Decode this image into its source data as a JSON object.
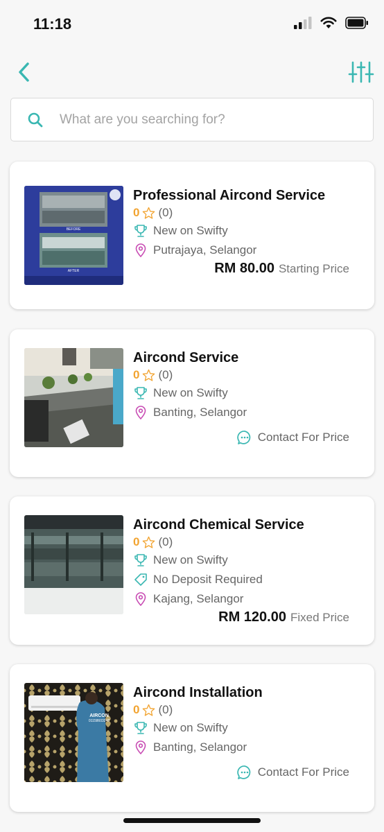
{
  "status_bar": {
    "time": "11:18"
  },
  "colors": {
    "accent": "#3ab7b2",
    "rating": "#f2a431",
    "location": "#c84bb3"
  },
  "search": {
    "placeholder": "What are you searching for?"
  },
  "icons": {
    "back": "chevron-left-icon",
    "filter": "sliders-icon",
    "search": "search-icon",
    "trophy": "trophy-icon",
    "location": "map-pin-icon",
    "tag": "tag-icon",
    "chat": "chat-bubble-icon"
  },
  "listings": [
    {
      "title": "Professional Aircond Service",
      "rating": "0",
      "rating_count": "(0)",
      "badge": "New on Swifty",
      "location": "Putrajaya, Selangor",
      "price": "RM 80.00",
      "price_note": "Starting Price"
    },
    {
      "title": "Aircond Service",
      "rating": "0",
      "rating_count": "(0)",
      "badge": "New on Swifty",
      "location": "Banting, Selangor",
      "contact": "Contact For Price"
    },
    {
      "title": "Aircond Chemical Service",
      "rating": "0",
      "rating_count": "(0)",
      "badge": "New on Swifty",
      "deposit": "No Deposit Required",
      "location": "Kajang, Selangor",
      "price": "RM 120.00",
      "price_note": "Fixed Price"
    },
    {
      "title": "Aircond Installation",
      "rating": "0",
      "rating_count": "(0)",
      "badge": "New on Swifty",
      "location": "Banting, Selangor",
      "contact": "Contact For Price",
      "thumb_text": {
        "line1": "AIRCON",
        "line2": "01158603248"
      }
    }
  ]
}
